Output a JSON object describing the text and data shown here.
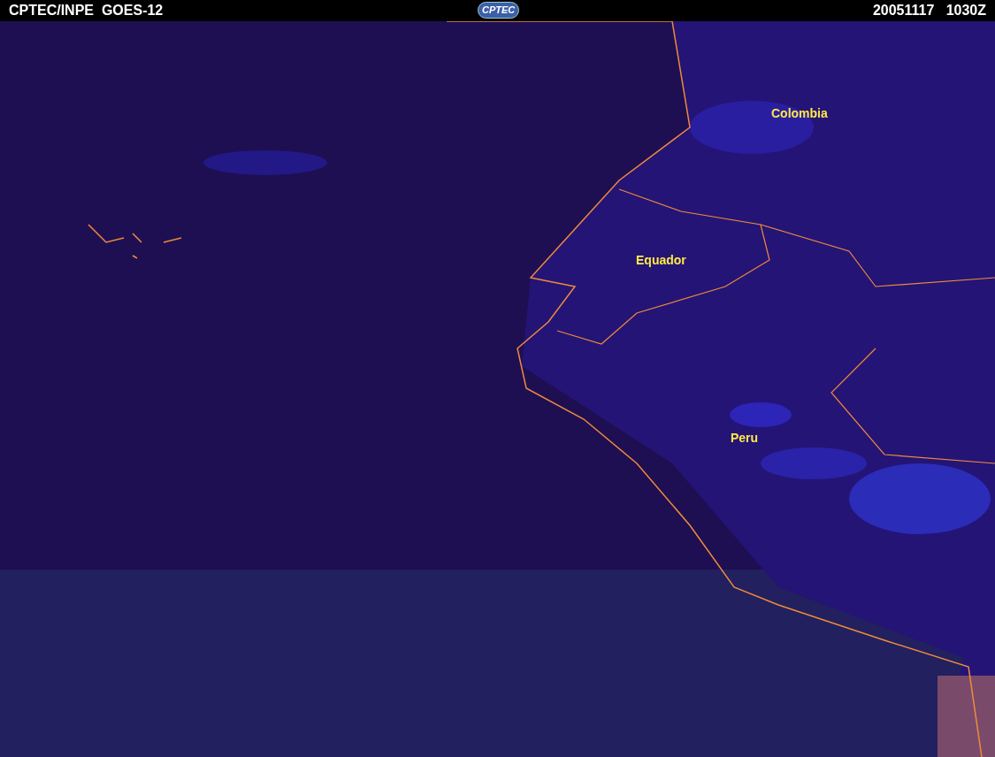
{
  "header": {
    "title": "CPTEC/INPE  GOES-12",
    "logo": "CPTEC",
    "timestamp": "20051117   1030Z"
  },
  "map_labels": [
    "Colombia",
    "Equador",
    "Peru"
  ]
}
